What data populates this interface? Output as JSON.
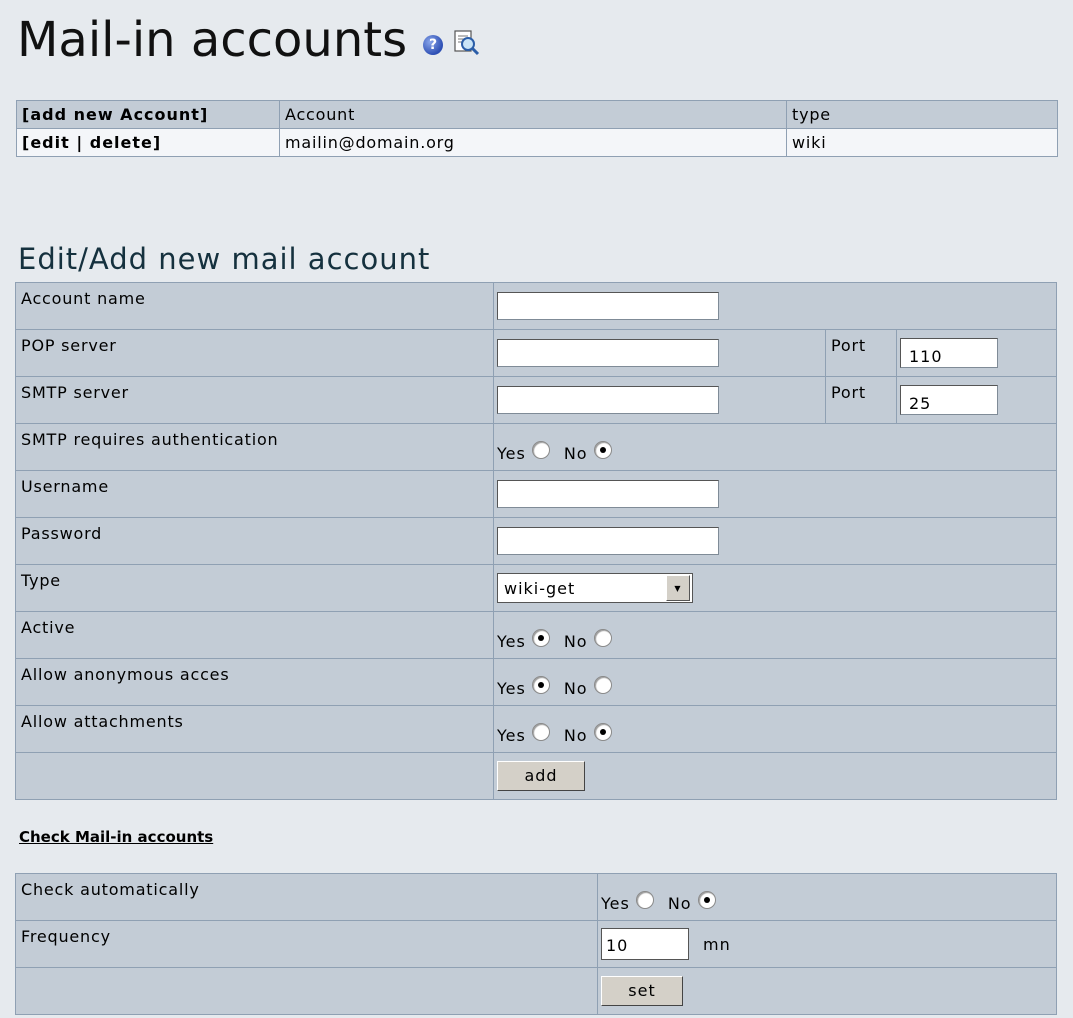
{
  "page_title": "Mail-in accounts",
  "accounts_table": {
    "headers": [
      "[add new Account]",
      "Account",
      "type"
    ],
    "rows": [
      {
        "actions": "[edit | delete]",
        "account": "mailin@domain.org",
        "type": "wiki"
      }
    ]
  },
  "edit_section": {
    "title": "Edit/Add new mail account",
    "account_name_label": "Account name",
    "pop_server_label": "POP server",
    "pop_port_label": "Port",
    "pop_port_value": "110",
    "smtp_server_label": "SMTP server",
    "smtp_port_label": "Port",
    "smtp_port_value": "25",
    "smtp_auth_label": "SMTP requires authentication",
    "username_label": "Username",
    "password_label": "Password",
    "type_label": "Type",
    "type_value": "wiki-get",
    "active_label": "Active",
    "anon_label": "Allow anonymous acces",
    "attach_label": "Allow attachments",
    "yes_label": "Yes",
    "no_label": "No",
    "add_button": "add",
    "smtp_auth_selected": "No",
    "active_selected": "Yes",
    "anon_selected": "Yes",
    "attach_selected": "No"
  },
  "check_section": {
    "title": "Check Mail-in accounts",
    "auto_label": "Check automatically",
    "auto_selected": "No",
    "frequency_label": "Frequency",
    "frequency_value": "10",
    "frequency_unit": "mn",
    "set_button": "set"
  },
  "icons": [
    "help-icon",
    "search-doc-icon"
  ]
}
